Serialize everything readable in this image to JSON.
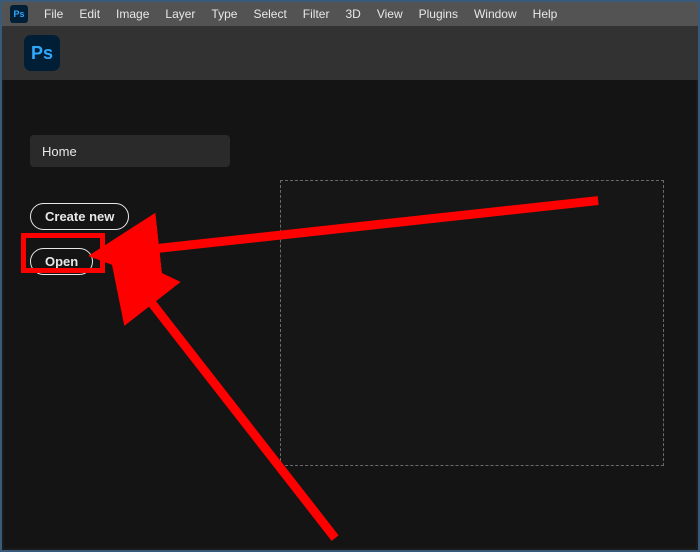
{
  "app": {
    "abbr": "Ps"
  },
  "menubar": {
    "items": [
      "File",
      "Edit",
      "Image",
      "Layer",
      "Type",
      "Select",
      "Filter",
      "3D",
      "View",
      "Plugins",
      "Window",
      "Help"
    ]
  },
  "home": {
    "home_label": "Home",
    "create_label": "Create new",
    "open_label": "Open"
  },
  "annotations": {
    "highlight_color": "#ff0000"
  }
}
